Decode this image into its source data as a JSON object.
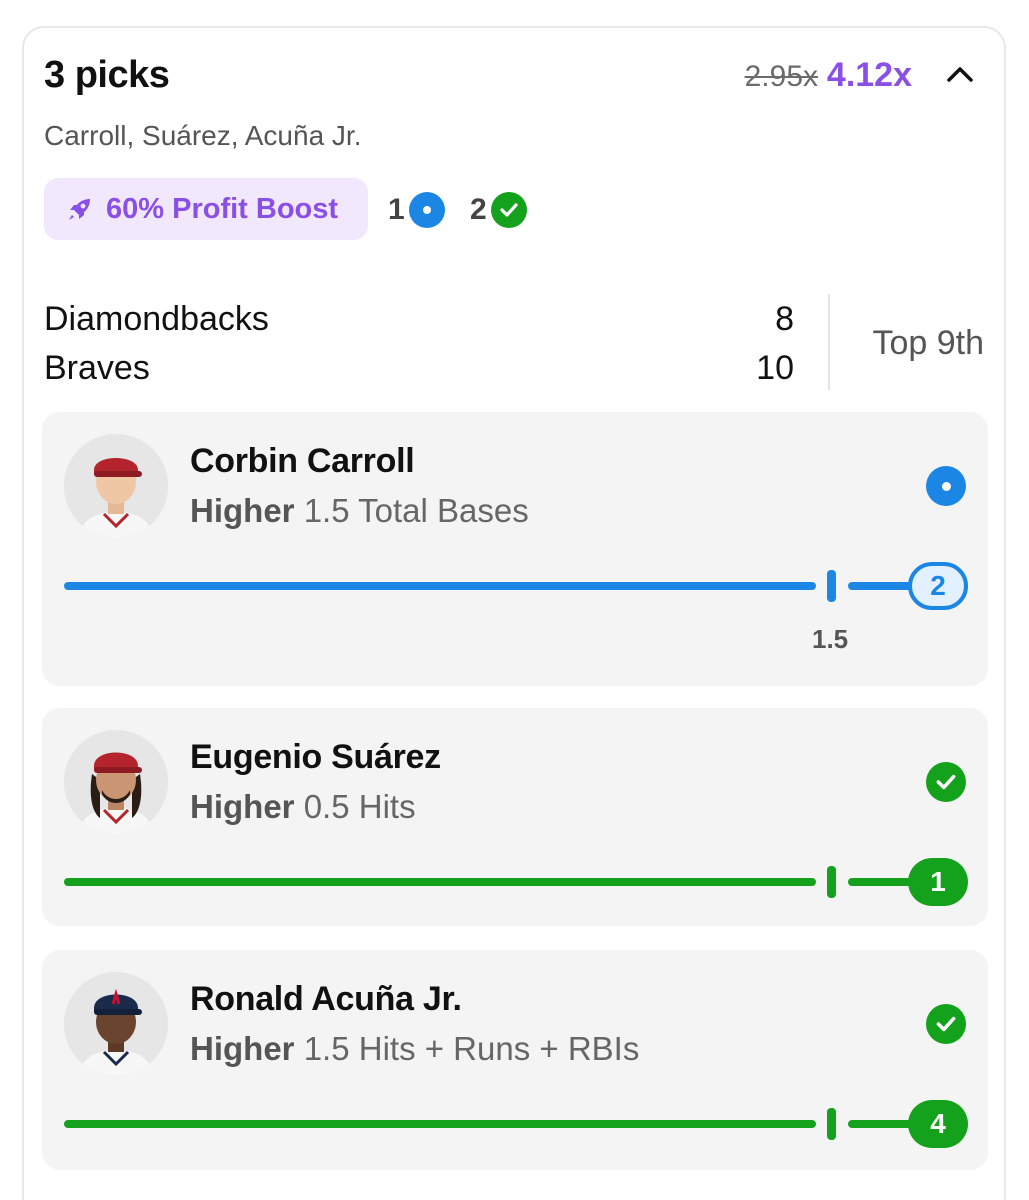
{
  "header": {
    "title": "3 picks",
    "old_multiplier": "2.95x",
    "new_multiplier": "4.12x",
    "subtitle": "Carroll, Suárez, Acuña Jr."
  },
  "boost": {
    "label": "60% Profit Boost"
  },
  "counts": {
    "pending": "1",
    "won": "2"
  },
  "game": {
    "teams": [
      {
        "name": "Diamondbacks",
        "score": "8"
      },
      {
        "name": "Braves",
        "score": "10"
      }
    ],
    "inning": "Top 9th"
  },
  "picks": [
    {
      "player": "Corbin Carroll",
      "direction": "Higher",
      "line": "1.5",
      "stat": "Total Bases",
      "current": "2",
      "status": "pending",
      "line_label": "1.5"
    },
    {
      "player": "Eugenio Suárez",
      "direction": "Higher",
      "line": "0.5",
      "stat": "Hits",
      "current": "1",
      "status": "won"
    },
    {
      "player": "Ronald Acuña Jr.",
      "direction": "Higher",
      "line": "1.5",
      "stat": "Hits + Runs + RBIs",
      "current": "4",
      "status": "won"
    }
  ],
  "colors": {
    "accent_purple": "#8a4fe6",
    "pending_blue": "#1c86e4",
    "won_green": "#14a11c",
    "boost_bg": "#f2e8fe"
  },
  "icons": {
    "collapse": "chevron-up-icon",
    "boost": "rocket-icon",
    "pending": "live-dot-icon",
    "won": "check-circle-icon"
  }
}
